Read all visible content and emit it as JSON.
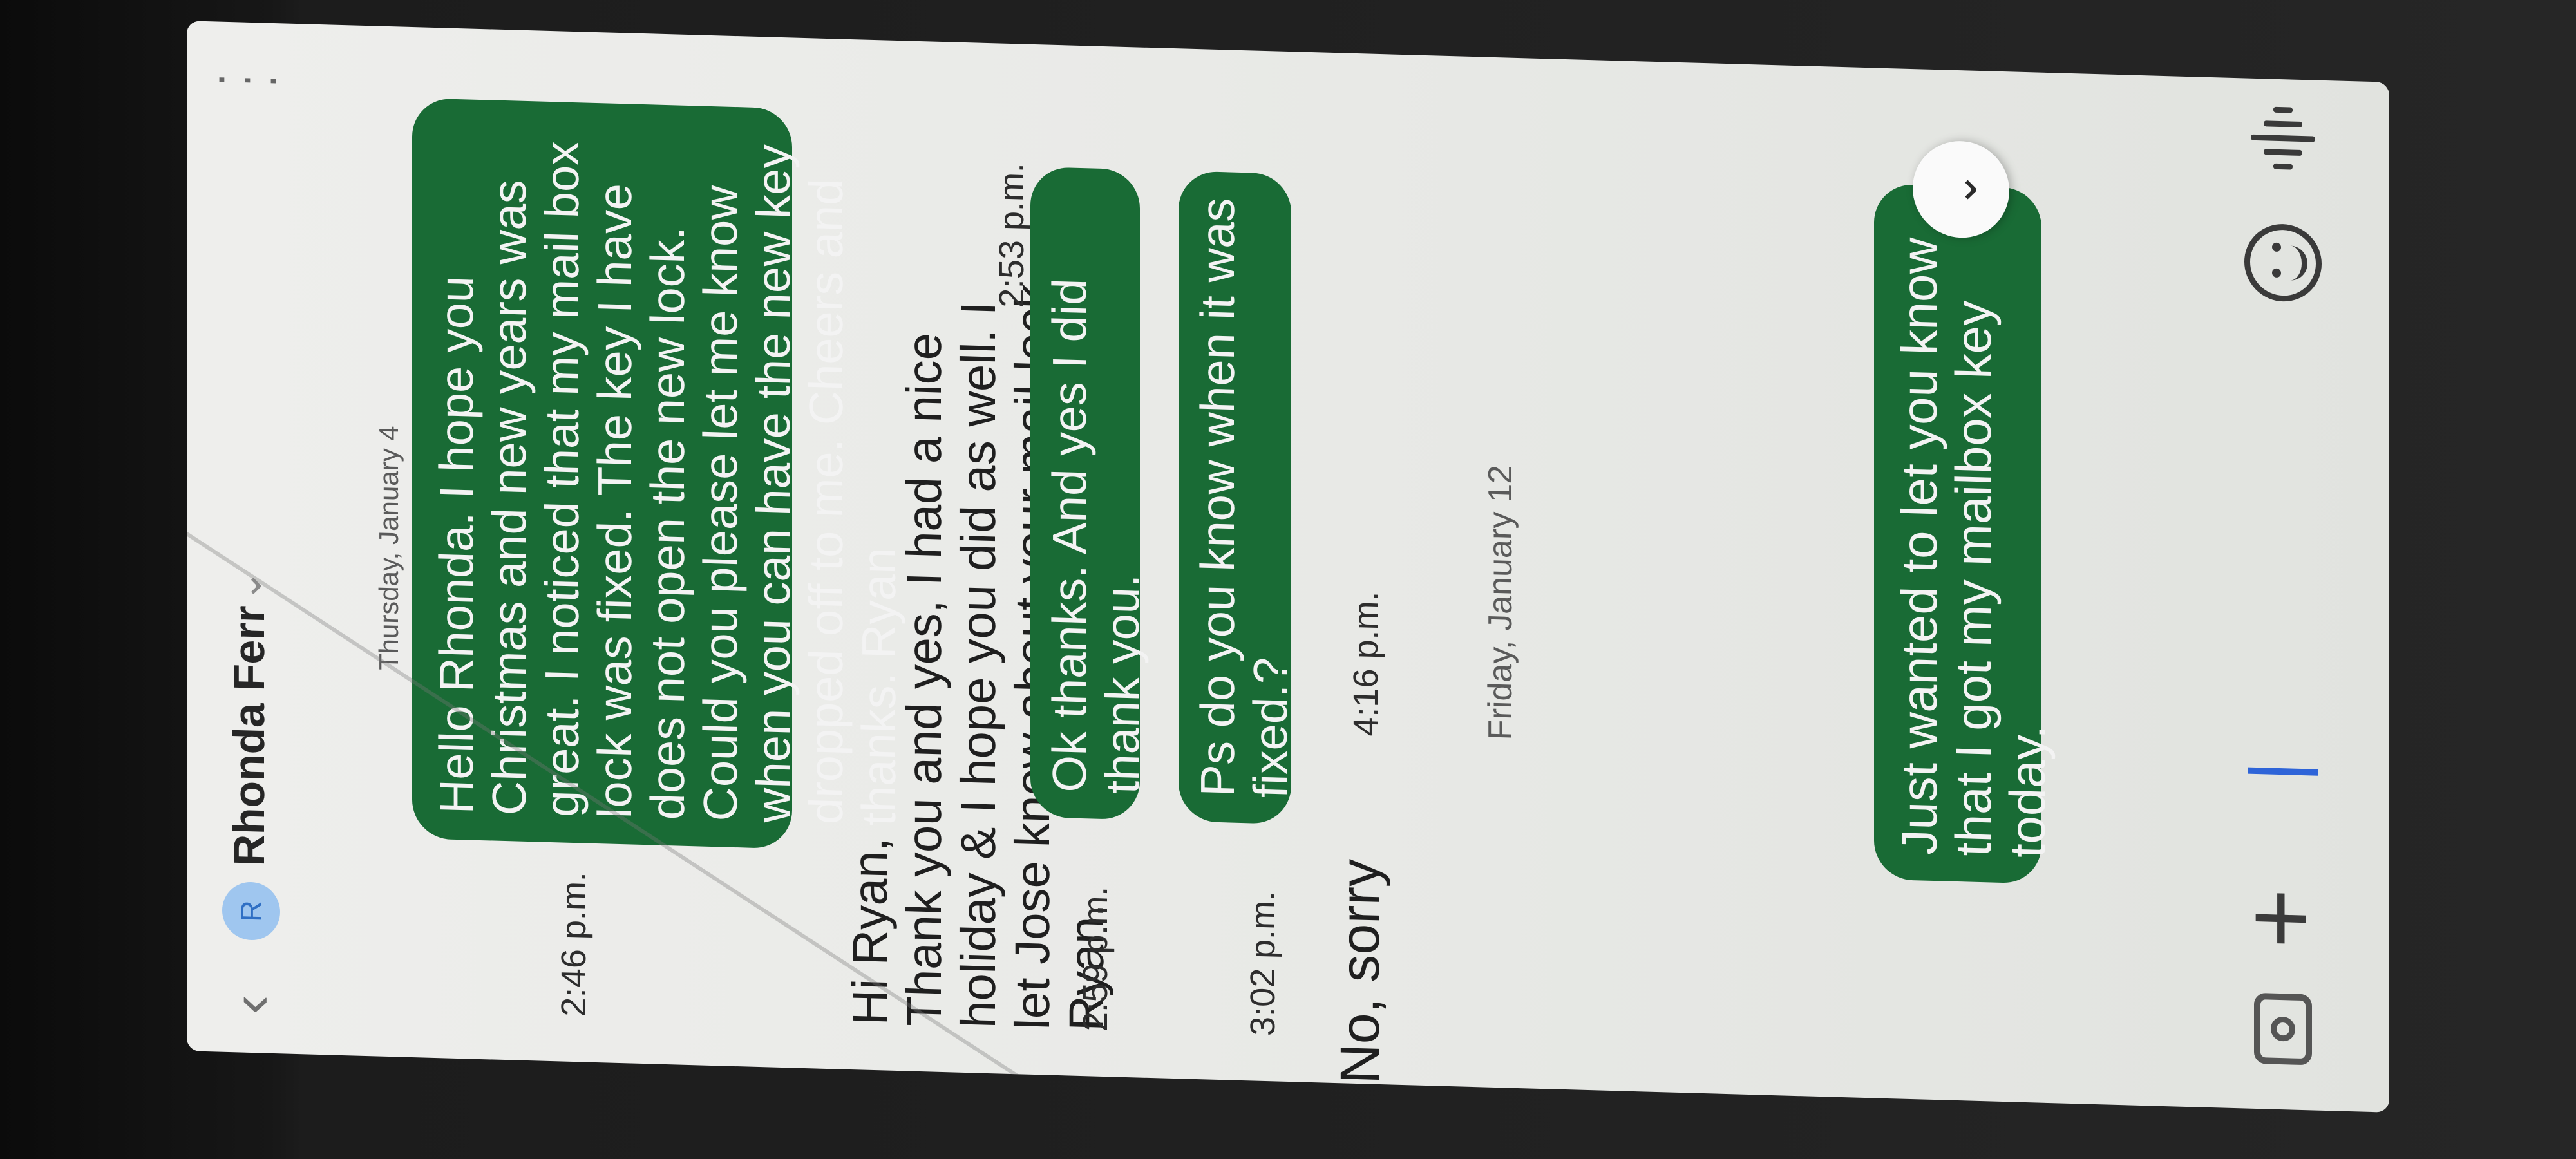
{
  "header": {
    "avatar_letter": "R",
    "contact_name": "Rhonda Ferr",
    "back_icon": "chevron-left-icon",
    "menu_icon": "more-vertical-icon"
  },
  "conversation": {
    "date_1": "Thursday, January 4",
    "msg_1": {
      "text": "Hello Rhonda.  I hope you Christmas and new years was great. I noticed that my mail box lock was fixed. The key I have does not open the new lock. Could you please let me know when you can have the new key dropped off to me. Cheers and thanks. Ryan",
      "time": "2:46 p.m."
    },
    "msg_2": {
      "text": "Hi Ryan,\nThank you and yes, I had a nice holiday & I hope you did as well. I let Jose know about your mail lock Ryan.",
      "time": "2:53 p.m."
    },
    "msg_3": {
      "text": "Ok thanks. And yes I did thank you.",
      "time": "2:59 p.m."
    },
    "msg_4": {
      "text": "Ps do you know when it was fixed.?",
      "time": "3:02 p.m."
    },
    "msg_5": {
      "text": "No, sorry",
      "time": "4:16 p.m."
    },
    "date_2": "Friday, January 12",
    "msg_6": {
      "text": "Just wanted to let you know that I got my mailbox key today."
    },
    "scroll_down_label": "⌄"
  },
  "composer": {
    "camera_icon": "camera-icon",
    "add_icon": "plus-icon",
    "emoji_icon": "emoji-icon",
    "voice_icon": "voice-input-icon"
  },
  "colors": {
    "outgoing_bubble": "#196b35",
    "screen_background": "#eeeeec",
    "avatar": "#9fc6ef"
  }
}
